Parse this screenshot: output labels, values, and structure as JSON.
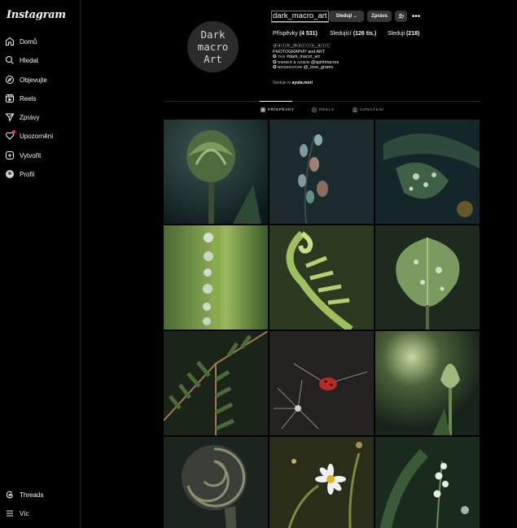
{
  "app": {
    "logo": "Instagram"
  },
  "nav": [
    {
      "label": "Domů",
      "icon": "home-icon"
    },
    {
      "label": "Hledat",
      "icon": "search-icon"
    },
    {
      "label": "Objevujte",
      "icon": "compass-icon"
    },
    {
      "label": "Reels",
      "icon": "reels-icon"
    },
    {
      "label": "Zprávy",
      "icon": "messages-icon"
    },
    {
      "label": "Upozornění",
      "icon": "heart-icon"
    },
    {
      "label": "Vytvořit",
      "icon": "create-icon"
    },
    {
      "label": "Profil",
      "icon": "profile-icon"
    }
  ],
  "nav_bottom": [
    {
      "label": "Threads",
      "icon": "threads-icon"
    },
    {
      "label": "Víc",
      "icon": "menu-icon"
    }
  ],
  "profile": {
    "avatar_text": "Dark\nmacro\nArt",
    "username": "dark_macro_art",
    "following_button": "Sleduji",
    "message_button": "Zpráva",
    "stats": {
      "posts_label": "Příspěvky",
      "posts_value": "(4 531)",
      "followers_label": "Sledující",
      "followers_value": "(126 tis.)",
      "following_label": "Sleduji",
      "following_value": "(218)"
    },
    "bio": {
      "name": "ⓓⓐⓡⓚ_ⓜⓐⓒⓡⓞ_ⓐⓡⓣ",
      "line1": "PHOTOGRAPHY and ART",
      "line2_label": "TAG",
      "line2_value": "#dark_macro_art",
      "line3_label": "OWNER & ADMIN",
      "line3_value": "@spiritmacres",
      "line4_label": "MODERATOR",
      "line4_value": "@_love_grams"
    },
    "followed_by_prefix": "Sleduje to",
    "followed_by_user": "ayuta.mori"
  },
  "tabs": {
    "posts": "PŘÍSPĚVKY",
    "reels": "REELS",
    "tagged": "OZNAČENÍ"
  },
  "colors": {
    "accent_notification": "#ff3040",
    "background": "#000000",
    "button": "#363636",
    "secondary_text": "#a8a8a8"
  }
}
